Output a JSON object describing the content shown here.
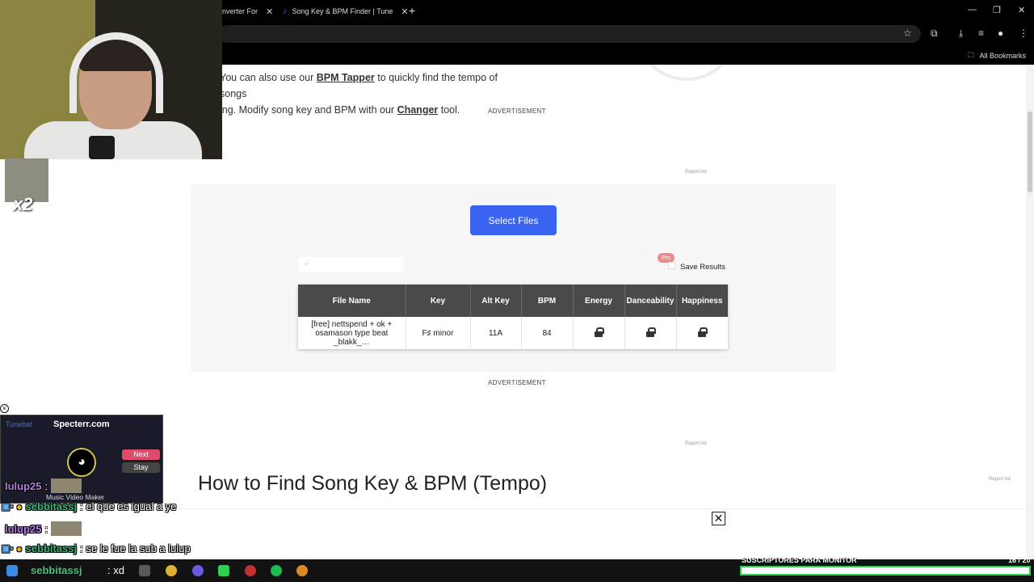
{
  "browser": {
    "tabs": [
      {
        "label": "onverter For",
        "close": "✕"
      },
      {
        "label": "Song Key & BPM Finder | Tune",
        "close": "✕"
      }
    ],
    "new_tab": "+",
    "window_controls": {
      "minimize": "—",
      "restore": "❐",
      "close": "✕"
    },
    "bookmarks_label": "All Bookmarks"
  },
  "page": {
    "intro_line1_prefix": "You can also use our ",
    "bpm_tapper_link": "BPM Tapper",
    "intro_line1_suffix": " to quickly find the tempo of songs",
    "intro_line2_prefix": "ing. Modify song key and BPM with our ",
    "changer_link": "Changer",
    "intro_line2_suffix": " tool.",
    "advertisement_label": "ADVERTISEMENT",
    "report_ad_label": "Report Ad",
    "select_files_label": "Select Files",
    "pro_badge": "Pro",
    "save_results_label": "Save Results",
    "table": {
      "headers": [
        "File Name",
        "Key",
        "Alt Key",
        "BPM",
        "Energy",
        "Danceability",
        "Happiness"
      ],
      "row": {
        "file_name": "[free] nettspend + ok + osamason type beat _blakk_…",
        "key": "F♯ minor",
        "alt_key": "11A",
        "bpm": "84"
      }
    },
    "howto_heading": "How to Find Song Key & BPM (Tempo)",
    "close_ad": "✕"
  },
  "stream_overlay": {
    "avatar_label": "x2",
    "widget": {
      "brand": "Tunebat",
      "site": "Specterr.com",
      "next": "Next",
      "stay": "Stay",
      "tagline": "Music Video Maker"
    },
    "chat": [
      {
        "user": "lulup25",
        "message": ":"
      },
      {
        "user": "sebbitassj",
        "message": ": el que es igual a ye"
      },
      {
        "user": "lulup25",
        "message": ":"
      },
      {
        "user": "sebbitassj",
        "message": ": se le fue la sub a lulup"
      }
    ],
    "taskbar_chat": {
      "user": "sebbitassj",
      "message": ": xd"
    },
    "sub_goal_label": "SUSCRIPTORES PARA MONITOR",
    "sub_goal_count": "16 / 20"
  },
  "colors": {
    "select_files_button": "#3b63f2",
    "table_header": "#4a4a4a",
    "pro_badge": "#ec8b8b",
    "chat_user_purple": "#b77ce8",
    "chat_user_green": "#3bb57a",
    "sub_goal_bar_border": "#2bd14f"
  },
  "icons": [
    "music-note-icon",
    "star-icon",
    "extensions-icon",
    "download-icon",
    "media-icon",
    "profile-icon",
    "menu-icon",
    "folder-icon",
    "search-icon",
    "lock-icon",
    "close-icon"
  ]
}
